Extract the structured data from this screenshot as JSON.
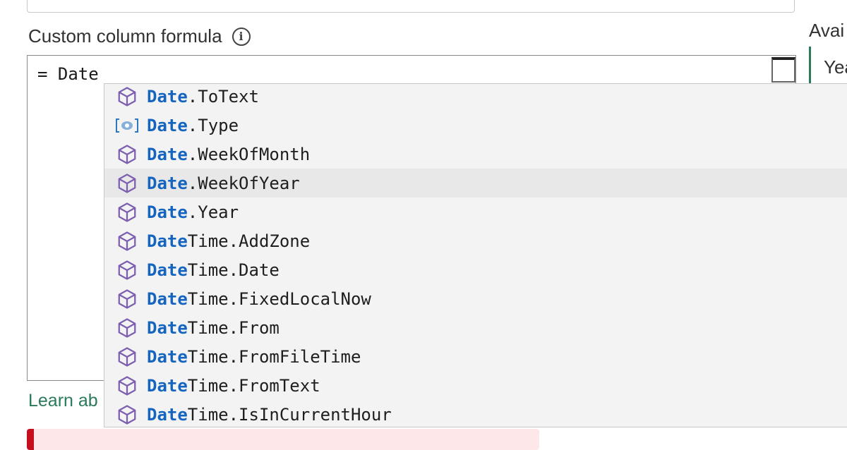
{
  "formula_label": "Custom column formula",
  "info_icon_glyph": "i",
  "available_columns_label": "Avai",
  "available_columns_first_item": "Yea",
  "editor_text": "= Date",
  "learn_link_text": "Learn ab",
  "colors": {
    "match_text": "#1565c0",
    "function_icon": "#7d5fb0",
    "type_icon": "#2b78c2",
    "link": "#2b7a5a",
    "error_bar": "#c50f1f"
  },
  "suggestions": [
    {
      "match": "Date",
      "rest": ".ToText",
      "icon": "function-icon"
    },
    {
      "match": "Date",
      "rest": ".Type",
      "icon": "type-icon"
    },
    {
      "match": "Date",
      "rest": ".WeekOfMonth",
      "icon": "function-icon"
    },
    {
      "match": "Date",
      "rest": ".WeekOfYear",
      "icon": "function-icon",
      "selected": true
    },
    {
      "match": "Date",
      "rest": ".Year",
      "icon": "function-icon"
    },
    {
      "match": "Date",
      "rest": "Time.AddZone",
      "icon": "function-icon"
    },
    {
      "match": "Date",
      "rest": "Time.Date",
      "icon": "function-icon"
    },
    {
      "match": "Date",
      "rest": "Time.FixedLocalNow",
      "icon": "function-icon"
    },
    {
      "match": "Date",
      "rest": "Time.From",
      "icon": "function-icon"
    },
    {
      "match": "Date",
      "rest": "Time.FromFileTime",
      "icon": "function-icon"
    },
    {
      "match": "Date",
      "rest": "Time.FromText",
      "icon": "function-icon"
    },
    {
      "match": "Date",
      "rest": "Time.IsInCurrentHour",
      "icon": "function-icon"
    }
  ]
}
